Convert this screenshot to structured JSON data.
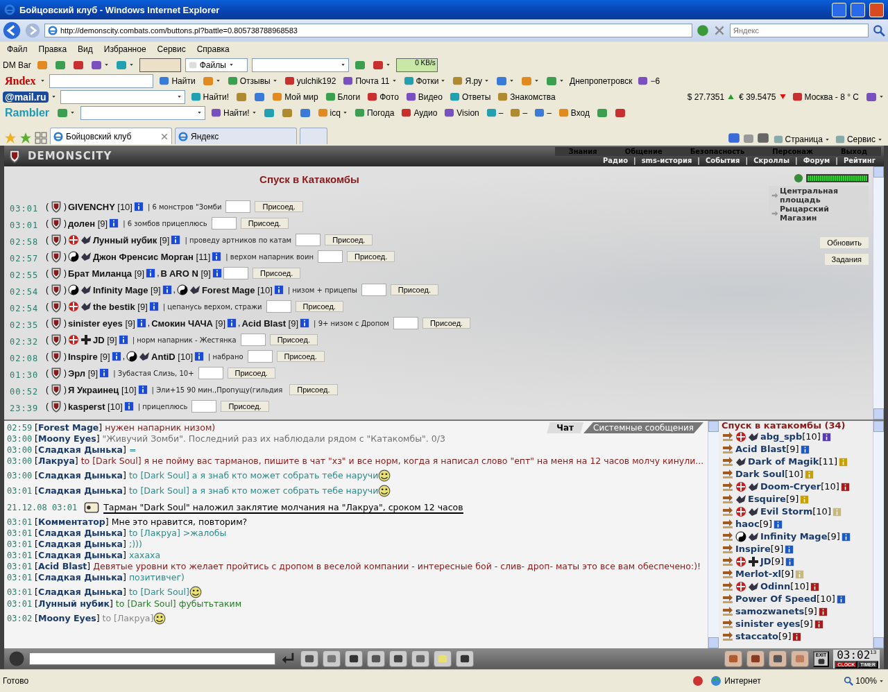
{
  "window": {
    "title": "Бойцовский клуб - Windows Internet Explorer"
  },
  "address": {
    "url": "http://demonscity.combats.com/buttons.pl?battle=0.805738788968583",
    "search_placeholder": "Яндекс"
  },
  "menu": [
    "Файл",
    "Правка",
    "Вид",
    "Избранное",
    "Сервис",
    "Справка"
  ],
  "toolbars": [
    [
      {
        "kind": "text",
        "label": "DM Bar"
      },
      {
        "kind": "icon",
        "dropdown": false
      },
      {
        "kind": "icon",
        "dropdown": false
      },
      {
        "kind": "icon",
        "dropdown": false
      },
      {
        "kind": "icon",
        "dropdown": true
      },
      {
        "kind": "icon",
        "dropdown": true
      },
      {
        "kind": "wide-icon"
      },
      {
        "kind": "select",
        "label": "Файлы"
      },
      {
        "kind": "combo"
      },
      {
        "kind": "icon",
        "dropdown": false
      },
      {
        "kind": "icon",
        "dropdown": true
      },
      {
        "kind": "meter",
        "label": "0 KB/s"
      }
    ],
    [
      {
        "kind": "logo",
        "label": "Яndex",
        "dropdown": true
      },
      {
        "kind": "field"
      },
      {
        "kind": "button",
        "label": "Найти",
        "dropdown": false
      },
      {
        "kind": "icon",
        "dropdown": true
      },
      {
        "kind": "button",
        "label": "Отзывы",
        "dropdown": true
      },
      {
        "kind": "button",
        "label": "yulchik192",
        "dropdown": false
      },
      {
        "kind": "button",
        "label": "Почта 11",
        "dropdown": true
      },
      {
        "kind": "button",
        "label": "Фотки",
        "dropdown": true
      },
      {
        "kind": "button",
        "label": "Я.ру",
        "dropdown": true
      },
      {
        "kind": "icon",
        "dropdown": true
      },
      {
        "kind": "icon",
        "dropdown": true
      },
      {
        "kind": "icon",
        "dropdown": true
      },
      {
        "kind": "text",
        "label": "Днепропетровск"
      },
      {
        "kind": "button",
        "label": "−6",
        "dropdown": false
      }
    ],
    [
      {
        "kind": "logo",
        "label": "@mail.ru",
        "dropdown": true
      },
      {
        "kind": "combo"
      },
      {
        "kind": "button",
        "label": "Найти!",
        "dropdown": false
      },
      {
        "kind": "icon",
        "dropdown": false
      },
      {
        "kind": "icon",
        "dropdown": false
      },
      {
        "kind": "button",
        "label": "Мой мир",
        "dropdown": false
      },
      {
        "kind": "button",
        "label": "Блоги",
        "dropdown": false
      },
      {
        "kind": "button",
        "label": "Фото",
        "dropdown": false
      },
      {
        "kind": "button",
        "label": "Видео",
        "dropdown": false
      },
      {
        "kind": "button",
        "label": "Ответы",
        "dropdown": false
      },
      {
        "kind": "button",
        "label": "Знакомства",
        "dropdown": false
      },
      {
        "kind": "spacer"
      },
      {
        "kind": "rate-up",
        "label": "$ 27.7351"
      },
      {
        "kind": "rate-down",
        "label": "€ 39.5475"
      },
      {
        "kind": "button",
        "label": "Москва  - 8 ° C",
        "dropdown": false
      },
      {
        "kind": "icon",
        "dropdown": true
      }
    ],
    [
      {
        "kind": "logo",
        "label": "Rambler",
        "dropdown": false
      },
      {
        "kind": "icon",
        "dropdown": true
      },
      {
        "kind": "combo"
      },
      {
        "kind": "button",
        "label": "Найти!",
        "dropdown": true
      },
      {
        "kind": "icon",
        "dropdown": false
      },
      {
        "kind": "icon",
        "dropdown": false
      },
      {
        "kind": "icon",
        "dropdown": false
      },
      {
        "kind": "button",
        "label": "icq",
        "dropdown": true
      },
      {
        "kind": "button",
        "label": "Погода",
        "dropdown": false
      },
      {
        "kind": "button",
        "label": "Аудио",
        "dropdown": false
      },
      {
        "kind": "button",
        "label": "Vision",
        "dropdown": false
      },
      {
        "kind": "button",
        "label": "–",
        "dropdown": false
      },
      {
        "kind": "button",
        "label": "–",
        "dropdown": false
      },
      {
        "kind": "button",
        "label": "–",
        "dropdown": false
      },
      {
        "kind": "button",
        "label": "Вход",
        "dropdown": false
      },
      {
        "kind": "icon",
        "dropdown": false
      },
      {
        "kind": "icon",
        "dropdown": false
      }
    ]
  ],
  "tabs": [
    {
      "label": "Бойцовский клуб",
      "selected": true
    },
    {
      "label": "Яндекс",
      "selected": false
    }
  ],
  "command_bar": [
    "Страница",
    "Сервис"
  ],
  "game": {
    "logo": "DEMONSCITY",
    "nav": [
      "Знания",
      "Общение",
      "Безопасность",
      "Персонаж",
      "Выход"
    ],
    "subnav": [
      {
        "label": "Радио"
      },
      {
        "sep": "|",
        "label": "sms-история"
      },
      {
        "sep": "|",
        "label": "События"
      },
      {
        "sep": "|",
        "label": "Скроллы"
      },
      {
        "sep": "|",
        "label": "Форум"
      },
      {
        "sep": "|",
        "label": "Рейтинг"
      }
    ],
    "title": "Спуск в Катакомбы",
    "groups": [
      {
        "time": "03:01",
        "open": "(",
        "close": ")",
        "members": [
          {
            "name": "GIVENCHY",
            "level": "[10]"
          }
        ],
        "comment": "| 6 монстров \"Зомби",
        "field": true,
        "button": "Присоед."
      },
      {
        "time": "03:01",
        "open": "(",
        "close": ")",
        "members": [
          {
            "name": "долен",
            "level": "[9]"
          }
        ],
        "comment": "| 6 зомбов прицеплюсь",
        "field": true,
        "button": "Присоед."
      },
      {
        "time": "02:58",
        "open": "(",
        "close": ")",
        "members": [
          {
            "name": "Лунный нубик",
            "level": "[9]",
            "emblems": [
              {
                "kind": "cross"
              },
              {
                "kind": "clan"
              }
            ]
          }
        ],
        "comment": "| проведу артников по катам",
        "field": true,
        "button": "Присоед."
      },
      {
        "time": "02:57",
        "open": "(",
        "close": ")",
        "members": [
          {
            "name": "Джон Френсис Морган",
            "level": "[11]",
            "emblems": [
              {
                "kind": "yinyang"
              },
              {
                "kind": "clan"
              }
            ]
          }
        ],
        "comment": "| верхом напарник воин",
        "field": true,
        "button": "Присоед."
      },
      {
        "time": "02:55",
        "open": "(",
        "close": ")",
        "members": [
          {
            "name": "Брат Миланца",
            "level": "[9]"
          },
          {
            "sep": ",",
            "name": "B ARO N",
            "level": "[9]"
          }
        ],
        "field": true,
        "button": "Присоед."
      },
      {
        "time": "02:54",
        "open": "(",
        "close": ")",
        "members": [
          {
            "name": "Infinity Mage",
            "level": "[9]",
            "emblems": [
              {
                "kind": "yinyang"
              },
              {
                "kind": "clan"
              }
            ]
          },
          {
            "sep": ",",
            "name": "Forest Mage",
            "level": "[10]",
            "emblems": [
              {
                "kind": "yinyang"
              },
              {
                "kind": "clan"
              }
            ]
          }
        ],
        "comment": "| низом + прицепы",
        "field": true,
        "button": "Присоед."
      },
      {
        "time": "02:54",
        "open": "(",
        "close": ")",
        "members": [
          {
            "name": "the bestik",
            "level": "[9]",
            "emblems": [
              {
                "kind": "cross"
              },
              {
                "kind": "clan"
              }
            ]
          }
        ],
        "comment": "| цепанусь верхом, стражи",
        "field": true,
        "button": "Присоед."
      },
      {
        "time": "02:35",
        "open": "(",
        "close": ")",
        "members": [
          {
            "name": "sinister eyes",
            "level": "[9]"
          },
          {
            "sep": ",",
            "name": "Смокин ЧАЧА",
            "level": "[9]"
          },
          {
            "sep": ",",
            "name": "Acid Blast",
            "level": "[9]"
          }
        ],
        "comment": "| 9+ низом с Дропом",
        "field": true,
        "button": "Присоед."
      },
      {
        "time": "02:32",
        "open": "(",
        "close": ")",
        "members": [
          {
            "name": "JD",
            "level": "[9]",
            "emblems": [
              {
                "kind": "cross"
              },
              {
                "kind": "ironcross"
              }
            ]
          }
        ],
        "comment": "| норм напарник - Жестянка",
        "field": true,
        "button": "Присоед."
      },
      {
        "time": "02:08",
        "open": "(",
        "close": ")",
        "members": [
          {
            "name": "Inspire",
            "level": "[9]"
          },
          {
            "sep": ",",
            "name": "AntiD",
            "level": "[10]",
            "emblems": [
              {
                "kind": "yinyang"
              },
              {
                "kind": "clan"
              }
            ]
          }
        ],
        "comment": "| набрано",
        "field": true,
        "button": "Присоед."
      },
      {
        "time": "01:30",
        "open": "(",
        "close": ")",
        "members": [
          {
            "name": "Эрл",
            "level": "[9]"
          }
        ],
        "comment": "| Зубастая Слизь, 10+",
        "field": true,
        "button": "Присоед."
      },
      {
        "time": "00:52",
        "open": "(",
        "close": ")",
        "members": [
          {
            "name": "Я Украинец",
            "level": "[10]"
          }
        ],
        "comment": "| Эли+15 90 мин.,Пропущу(гильдия",
        "field": false,
        "button": "Присоед."
      },
      {
        "time": "23:39",
        "open": "(",
        "close": ")",
        "members": [
          {
            "name": "kasperst",
            "level": "[10]"
          }
        ],
        "comment": "| прицеплюсь",
        "field": true,
        "button": "Присоед."
      }
    ],
    "health": {
      "level": 1
    },
    "locations": [
      "Центральная площадь",
      "Рыцарский Магазин"
    ],
    "side_buttons": [
      "Обновить",
      "Задания"
    ],
    "chat_tabs": [
      {
        "label": "Чат",
        "selected": true
      },
      {
        "label": "Системные сообщения",
        "selected": false
      }
    ],
    "chat": [
      {
        "kind": "message",
        "time": "02:59",
        "nick": "[**Forest Mage**]",
        "text": "нужен напарник низом)",
        "color": "#8b1a1a",
        "emoticon": false
      },
      {
        "kind": "message",
        "time": "03:00",
        "nick": "[**Moony Eyes**]",
        "text": "\"Живучий Зомби\". Последний раз их наблюдали рядом с \"Катакомбы\". 0/3",
        "color": "#707070",
        "emoticon": false
      },
      {
        "kind": "message",
        "time": "03:00",
        "nick": "[**Сладкая Дынька**]",
        "text": "=",
        "color": "#2e8b8b",
        "emoticon": false
      },
      {
        "kind": "message",
        "time": "03:00",
        "nick": "[**Лакруа**]",
        "text": "to [Dark Soul] я не пойму вас тарманов, пишите в чат \"хз\" и все норм, когда я написал слово \"епт\" на меня на 12 часов молчу кинули...",
        "color": "#8b1a1a",
        "emoticon": false
      },
      {
        "kind": "message",
        "time": "03:00",
        "nick": "[**Сладкая Дынька**]",
        "text": "to [Dark Soul] а я знаб кто может собрать тебе наручи",
        "color": "#2e8b8b",
        "emoticon": true
      },
      {
        "kind": "message",
        "time": "03:01",
        "nick": "[**Сладкая Дынька**]",
        "text": "to [Dark Soul] а я знаб кто может собрать тебе наручи",
        "color": "#2e8b8b",
        "emoticon": true
      },
      {
        "kind": "system",
        "time": "21.12.08 03:01",
        "text": "Тарман \"Dark Soul\" наложил заклятие молчания на \"Лакруа\", сроком 12 часов",
        "color": "#000000",
        "emoticon": false
      },
      {
        "kind": "message",
        "time": "03:01",
        "nick": "[**Комментатор**]",
        "text": "Мне это нравится, повторим?",
        "color": "#000000",
        "emoticon": false
      },
      {
        "kind": "message",
        "time": "03:01",
        "nick": "[**Сладкая Дынька**]",
        "text": "to [Лакруа] >жалобы",
        "color": "#2e8b8b",
        "emoticon": false
      },
      {
        "kind": "message",
        "time": "03:01",
        "nick": "[**Сладкая Дынька**]",
        "text": ";)))",
        "color": "#2e8b8b",
        "emoticon": false
      },
      {
        "kind": "message",
        "time": "03:01",
        "nick": "[**Сладкая Дынька**]",
        "text": "хахаха",
        "color": "#2e8b8b",
        "emoticon": false
      },
      {
        "kind": "message",
        "time": "03:01",
        "nick": "[**Acid Blast**]",
        "text": "Девятые уровни кто желает пройтись с дропом в веселой компании - интересные бой - слив- дроп- маты это все вам обеспечено:)!",
        "color": "#8b1a1a",
        "emoticon": false
      },
      {
        "kind": "message",
        "time": "03:01",
        "nick": "[**Сладкая Дынька**]",
        "text": "позитивчег)",
        "color": "#2e8b8b",
        "emoticon": false
      },
      {
        "kind": "message",
        "time": "03:01",
        "nick": "[**Сладкая Дынька**]",
        "text": "to [Dark Soul]",
        "color": "#2e8b8b",
        "emoticon": true
      },
      {
        "kind": "message",
        "time": "03:01",
        "nick": "[**Лунный нубик**]",
        "text": "to [Dark Soul] фубытьтаким",
        "color": "#2a7a2a",
        "emoticon": false
      },
      {
        "kind": "message",
        "time": "03:02",
        "nick": "[**Moony Eyes**]",
        "text": "to [Лакруа]",
        "color": "#8a8a8a",
        "emoticon": true
      }
    ],
    "players_title": "Спуск в катакомбы (34)",
    "players": [
      {
        "name": "abg_spb",
        "level": "[10]",
        "emblems": [
          {
            "kind": "cross"
          },
          {
            "kind": "clan"
          }
        ],
        "color": "#5a3ab0"
      },
      {
        "name": "Acid Blast",
        "level": "[9]",
        "color": "#1a5ac8"
      },
      {
        "name": "Dark of Magik",
        "level": "[11]",
        "emblems": [
          {
            "kind": "clan"
          }
        ],
        "color": "#c8a000"
      },
      {
        "name": "Dark Soul",
        "level": "[10]",
        "color": "#c8a000"
      },
      {
        "name": "Doom-Cryer",
        "level": "[10]",
        "emblems": [
          {
            "kind": "cross"
          },
          {
            "kind": "clan"
          }
        ],
        "color": "#b01818"
      },
      {
        "name": "Esquire",
        "level": "[9]",
        "emblems": [
          {
            "kind": "clan"
          }
        ],
        "color": "#c8a000"
      },
      {
        "name": "Evil Storm",
        "level": "[10]",
        "emblems": [
          {
            "kind": "cross"
          },
          {
            "kind": "clan"
          }
        ],
        "color": "#c8b878"
      },
      {
        "name": "haoc",
        "level": "[9]",
        "color": "#1a5ac8"
      },
      {
        "name": "Infinity Mage",
        "level": "[9]",
        "emblems": [
          {
            "kind": "yinyang"
          },
          {
            "kind": "clan"
          }
        ],
        "color": "#1a5ac8"
      },
      {
        "name": "Inspire",
        "level": "[9]",
        "color": "#1a5ac8"
      },
      {
        "name": "JD",
        "level": "[9]",
        "emblems": [
          {
            "kind": "cross"
          },
          {
            "kind": "ironcross"
          }
        ],
        "color": "#1a5ac8"
      },
      {
        "name": "Merlot-xl",
        "level": "[9]",
        "color": "#c8b878"
      },
      {
        "name": "Odinn",
        "level": "[10]",
        "emblems": [
          {
            "kind": "cross"
          },
          {
            "kind": "clan"
          }
        ],
        "color": "#b01818"
      },
      {
        "name": "Power Of Speed",
        "level": "[10]",
        "color": "#1a5ac8"
      },
      {
        "name": "samozwanets",
        "level": "[9]",
        "color": "#b01818"
      },
      {
        "name": "sinister eyes",
        "level": "[9]",
        "color": "#b01818"
      },
      {
        "name": "staccato",
        "level": "[9]",
        "color": "#b01818"
      }
    ],
    "exit_label": "EXIT",
    "clock": {
      "time": "03:02",
      "seconds": "13",
      "labels": [
        "CLOCK",
        "TIMER"
      ]
    }
  },
  "status_bar": {
    "text": "Готово",
    "zone": "Интернет",
    "zoom": "100%"
  }
}
